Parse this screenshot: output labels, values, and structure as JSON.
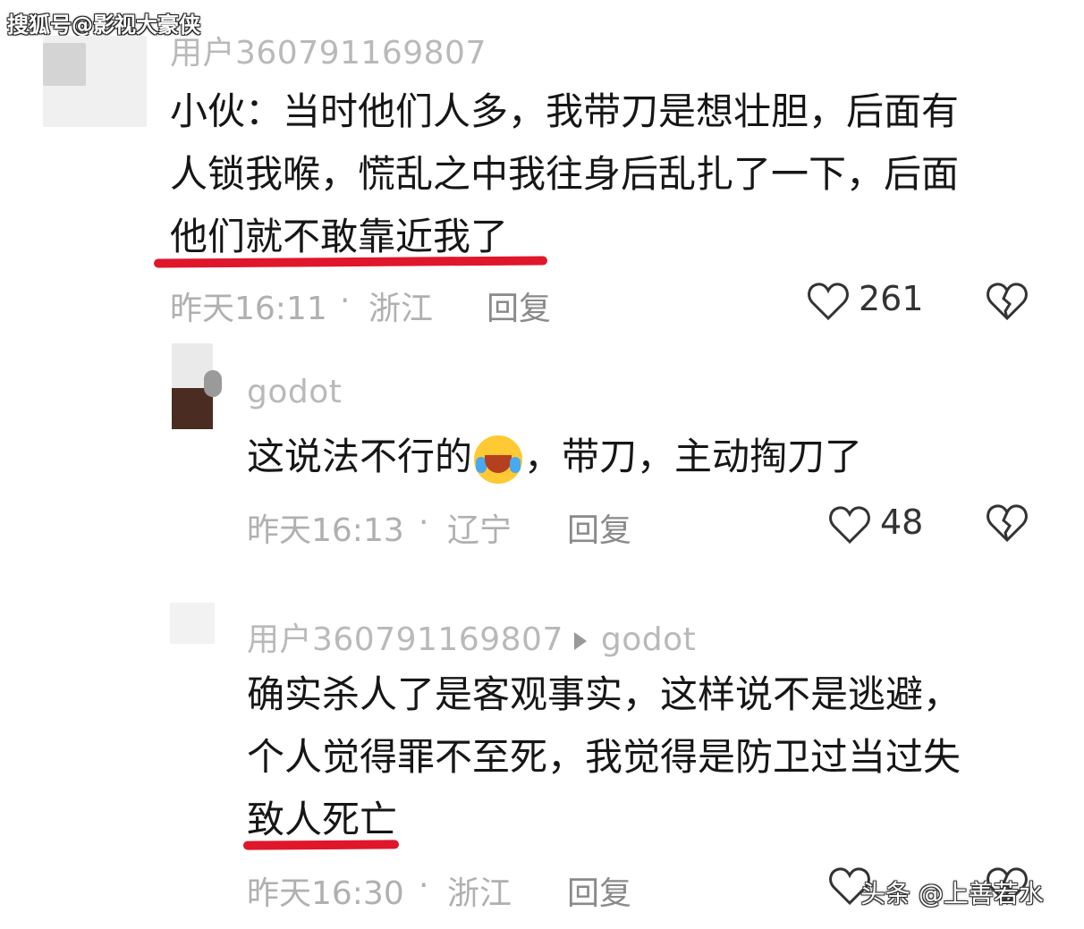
{
  "watermark_top": "搜狐号@影视大豪侠",
  "watermark_bottom": "头条 @上善若水",
  "comments": [
    {
      "user": "用户360791169807",
      "lines": [
        "小伙：当时他们人多，我带刀是想壮胆，后面有",
        "人锁我喉，慌乱之中我往身后乱扎了一下，后面",
        "他们就不敢靠近我了"
      ],
      "time": "昨天16:11",
      "dot": "·",
      "location": "浙江",
      "reply": "回复",
      "likes": "261"
    },
    {
      "user": "godot",
      "text_before_emoji": "这说法不行的",
      "emoji": "rolling-laughing-emoji",
      "text_after_emoji": "，带刀，主动掏刀了",
      "time": "昨天16:13",
      "dot": "·",
      "location": "辽宁",
      "reply": "回复",
      "likes": "48"
    },
    {
      "user": "用户360791169807",
      "reply_to": "godot",
      "lines": [
        "确实杀人了是客观事实，这样说不是逃避，",
        "个人觉得罪不至死，我觉得是防卫过当过失",
        "致人死亡"
      ],
      "time": "昨天16:30",
      "dot": "·",
      "location": "浙江",
      "reply": "回复"
    }
  ],
  "colors": {
    "underline": "#e0162b",
    "meta": "#b0b0b0"
  },
  "icons": [
    "heart-outline-icon",
    "broken-heart-icon",
    "reply-arrow-icon"
  ]
}
